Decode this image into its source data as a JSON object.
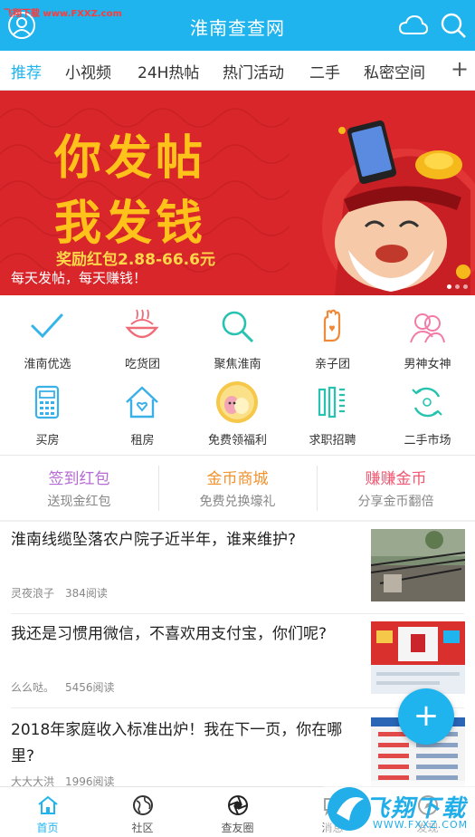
{
  "watermark_top": "飞翔下载 www.FXXZ.com",
  "header": {
    "title": "淮南查查网",
    "avatar_icon": "user-avatar-icon",
    "cloud_icon": "cloud-icon",
    "search_icon": "search-icon",
    "bg_color": "#1fb4ee"
  },
  "tabs": [
    {
      "label": "推荐",
      "active": true
    },
    {
      "label": "小视频"
    },
    {
      "label": "24H热帖"
    },
    {
      "label": "热门活动"
    },
    {
      "label": "二手"
    },
    {
      "label": "私密空间"
    }
  ],
  "tab_plus": "+",
  "banner": {
    "headline1": "你发帖",
    "headline2": "我发钱",
    "reward": "奖励红包2.88-66.6元",
    "caption": "每天发帖，每天赚钱！"
  },
  "grid": [
    {
      "label": "淮南优选",
      "icon": "check-icon",
      "color": "#35b5e8"
    },
    {
      "label": "吃货团",
      "icon": "food-bowl-icon",
      "color": "#f06b78"
    },
    {
      "label": "聚焦淮南",
      "icon": "magnifier-icon",
      "color": "#27c2b0"
    },
    {
      "label": "亲子团",
      "icon": "hand-heart-icon",
      "color": "#f08a3a"
    },
    {
      "label": "男神女神",
      "icon": "couple-icon",
      "color": "#f27ca8"
    },
    {
      "label": "买房",
      "icon": "calculator-icon",
      "color": "#3ab0e8"
    },
    {
      "label": "租房",
      "icon": "house-heart-icon",
      "color": "#3ab0e8"
    },
    {
      "label": "免费领福利",
      "icon": "gift-egg-icon",
      "color": "#f6c84a"
    },
    {
      "label": "求职招聘",
      "icon": "briefcase-icon",
      "color": "#27c2b0"
    },
    {
      "label": "二手市场",
      "icon": "recycle-icon",
      "color": "#27c2b0"
    }
  ],
  "promos": [
    {
      "title": "签到红包",
      "sub": "送现金红包",
      "color": "#b56ad6"
    },
    {
      "title": "金币商城",
      "sub": "免费兑换壕礼",
      "color": "#f0922e"
    },
    {
      "title": "赚赚金币",
      "sub": "分享金币翻倍",
      "color": "#f2556f"
    }
  ],
  "news": [
    {
      "title": "淮南线缆坠落农户院子近半年，谁来维护?",
      "author": "灵夜浪子",
      "reads": "384阅读"
    },
    {
      "title": "我还是习惯用微信，不喜欢用支付宝，你们呢?",
      "author": "么么哒。",
      "reads": "5456阅读"
    },
    {
      "title": "2018年家庭收入标准出炉！我在下一页，你在哪里?",
      "author": "大大大洪",
      "reads": "1996阅读"
    }
  ],
  "fab": "+",
  "bottom_nav": [
    {
      "label": "首页",
      "icon": "home-icon",
      "active": true
    },
    {
      "label": "社区",
      "icon": "globe-icon"
    },
    {
      "label": "查友圈",
      "icon": "camera-shutter-icon"
    },
    {
      "label": "消息",
      "icon": "message-icon"
    },
    {
      "label": "发现",
      "icon": "discover-icon"
    }
  ],
  "watermark_bottom": {
    "title": "飞翔下载",
    "url": "WWW.FXXZ.COM"
  }
}
